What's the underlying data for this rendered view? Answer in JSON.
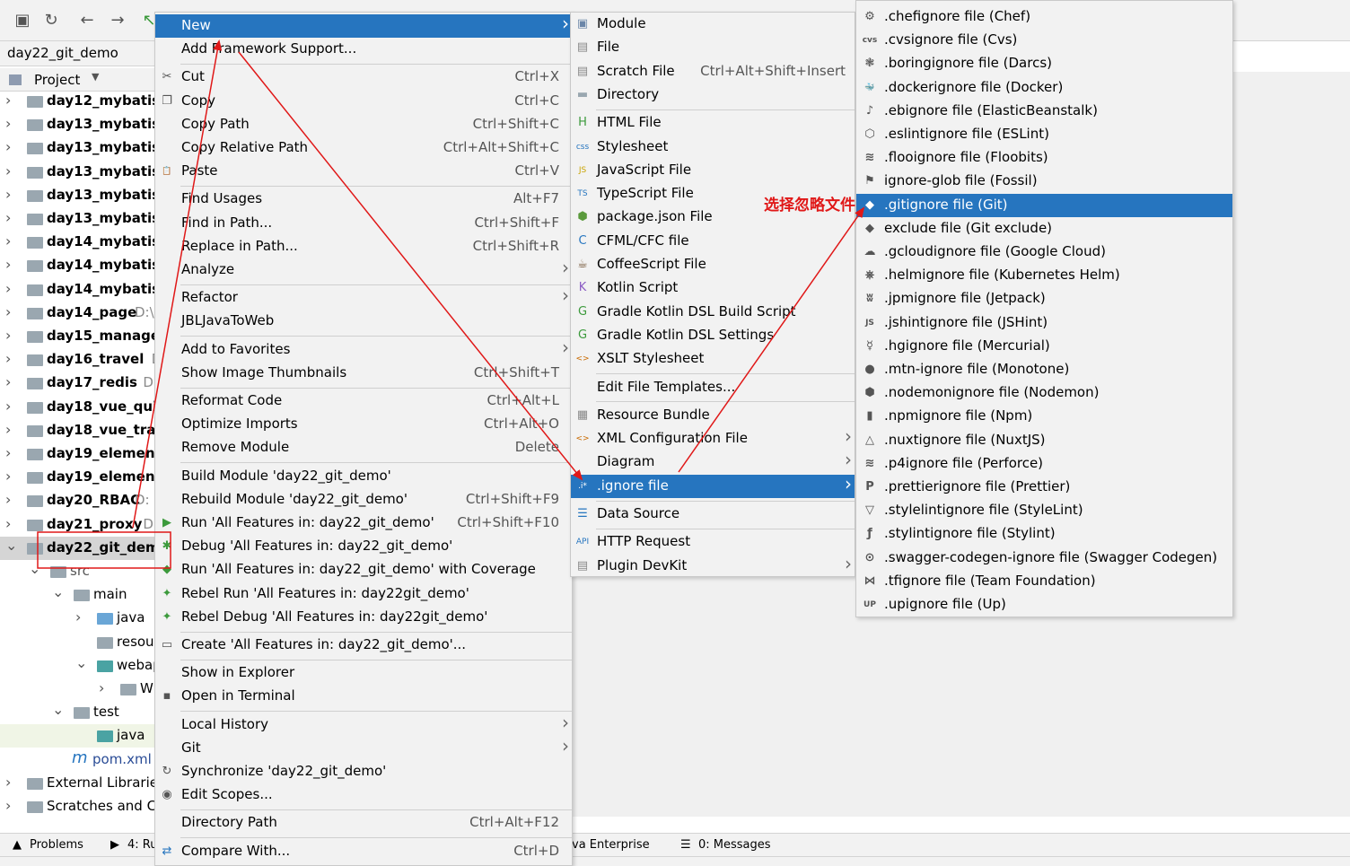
{
  "nav": {
    "project_name": "day22_git_demo"
  },
  "project_panel": {
    "title": "Project"
  },
  "tree": [
    {
      "label": "day12_mybatis",
      "level": 0,
      "expanded": false
    },
    {
      "label": "day13_mybatis_",
      "level": 0,
      "expanded": false
    },
    {
      "label": "day13_mybatis_",
      "level": 0,
      "expanded": false
    },
    {
      "label": "day13_mybatis_",
      "level": 0,
      "expanded": false
    },
    {
      "label": "day13_mybatis_",
      "level": 0,
      "expanded": false
    },
    {
      "label": "day13_mybatis_",
      "level": 0,
      "expanded": false
    },
    {
      "label": "day14_mybatis_",
      "level": 0,
      "expanded": false
    },
    {
      "label": "day14_mybatis_",
      "level": 0,
      "expanded": false
    },
    {
      "label": "day14_mybatis_",
      "level": 0,
      "expanded": false
    },
    {
      "label": "day14_page",
      "hint": "D:\\",
      "level": 0,
      "expanded": false
    },
    {
      "label": "day15_manager",
      "level": 0,
      "expanded": false
    },
    {
      "label": "day16_travel",
      "hint": "D:",
      "level": 0,
      "expanded": false
    },
    {
      "label": "day17_redis",
      "hint": "D:\\",
      "level": 0,
      "expanded": false
    },
    {
      "label": "day18_vue_quic",
      "level": 0,
      "expanded": false
    },
    {
      "label": "day18_vue_trav",
      "level": 0,
      "expanded": false
    },
    {
      "label": "day19_element",
      "level": 0,
      "expanded": false
    },
    {
      "label": "day19_element",
      "level": 0,
      "expanded": false
    },
    {
      "label": "day20_RBAC",
      "hint": "D:",
      "level": 0,
      "expanded": false
    },
    {
      "label": "day21_proxy",
      "hint": "D:",
      "level": 0,
      "expanded": false
    },
    {
      "label": "day22_git_demo",
      "level": 0,
      "expanded": true,
      "selected": true
    },
    {
      "label": "src",
      "level": 1,
      "expanded": true
    },
    {
      "label": "main",
      "level": 2,
      "expanded": true
    },
    {
      "label": "java",
      "level": 3,
      "expanded": false,
      "folder": "blue"
    },
    {
      "label": "resour",
      "level": 3,
      "leaf": true
    },
    {
      "label": "webap",
      "level": 3,
      "expanded": true,
      "folder": "teal"
    },
    {
      "label": "WI",
      "level": 4,
      "expanded": false
    },
    {
      "label": "test",
      "level": 2,
      "expanded": true
    },
    {
      "label": "java",
      "level": 3,
      "leaf": true,
      "folder": "teal",
      "highlighted": true
    },
    {
      "label": "pom.xml",
      "level": 1,
      "leaf": true,
      "file": "m"
    },
    {
      "label": "External Librarie",
      "level": 0,
      "expanded": false,
      "normal": true
    },
    {
      "label": "Scratches and Co",
      "level": 0,
      "expanded": false,
      "normal": true
    }
  ],
  "context_menu": {
    "items": [
      {
        "label": "New",
        "submenu": true,
        "active": true
      },
      {
        "label": "Add Framework Support..."
      },
      {
        "sep": true
      },
      {
        "label": "Cut",
        "shortcut": "Ctrl+X",
        "icon": "✂"
      },
      {
        "label": "Copy",
        "shortcut": "Ctrl+C",
        "icon": "❐"
      },
      {
        "label": "Copy Path",
        "shortcut": "Ctrl+Shift+C"
      },
      {
        "label": "Copy Relative Path",
        "shortcut": "Ctrl+Alt+Shift+C"
      },
      {
        "label": "Paste",
        "shortcut": "Ctrl+V",
        "icon": "📋"
      },
      {
        "sep": true
      },
      {
        "label": "Find Usages",
        "shortcut": "Alt+F7"
      },
      {
        "label": "Find in Path...",
        "shortcut": "Ctrl+Shift+F"
      },
      {
        "label": "Replace in Path...",
        "shortcut": "Ctrl+Shift+R"
      },
      {
        "label": "Analyze",
        "submenu": true
      },
      {
        "sep": true
      },
      {
        "label": "Refactor",
        "submenu": true
      },
      {
        "label": "JBLJavaToWeb"
      },
      {
        "sep": true
      },
      {
        "label": "Add to Favorites",
        "submenu": true
      },
      {
        "label": "Show Image Thumbnails",
        "shortcut": "Ctrl+Shift+T"
      },
      {
        "sep": true
      },
      {
        "label": "Reformat Code",
        "shortcut": "Ctrl+Alt+L"
      },
      {
        "label": "Optimize Imports",
        "shortcut": "Ctrl+Alt+O"
      },
      {
        "label": "Remove Module",
        "shortcut": "Delete"
      },
      {
        "sep": true
      },
      {
        "label": "Build Module 'day22_git_demo'"
      },
      {
        "label": "Rebuild Module 'day22_git_demo'",
        "shortcut": "Ctrl+Shift+F9"
      },
      {
        "label": "Run 'All Features in: day22_git_demo'",
        "shortcut": "Ctrl+Shift+F10",
        "icon": "▶",
        "iconColor": "#3c9a3c"
      },
      {
        "label": "Debug 'All Features in: day22_git_demo'",
        "icon": "✱",
        "iconColor": "#3c9a3c"
      },
      {
        "label": "Run 'All Features in: day22_git_demo' with Coverage",
        "icon": "◆",
        "iconColor": "#3c9a3c"
      },
      {
        "label": "Rebel Run 'All Features in: day22git_demo'",
        "icon": "✦",
        "iconColor": "#3c9a3c"
      },
      {
        "label": "Rebel Debug 'All Features in: day22git_demo'",
        "icon": "✦",
        "iconColor": "#3c9a3c"
      },
      {
        "sep": true
      },
      {
        "label": "Create 'All Features in: day22_git_demo'...",
        "icon": "▭"
      },
      {
        "sep": true
      },
      {
        "label": "Show in Explorer"
      },
      {
        "label": "Open in Terminal",
        "icon": "▪"
      },
      {
        "sep": true
      },
      {
        "label": "Local History",
        "submenu": true
      },
      {
        "label": "Git",
        "submenu": true
      },
      {
        "label": "Synchronize 'day22_git_demo'",
        "icon": "↻"
      },
      {
        "label": "Edit Scopes...",
        "icon": "◉"
      },
      {
        "sep": true
      },
      {
        "label": "Directory Path",
        "shortcut": "Ctrl+Alt+F12"
      },
      {
        "sep": true
      },
      {
        "label": "Compare With...",
        "shortcut": "Ctrl+D",
        "icon": "⇄",
        "iconColor": "#2675bf"
      }
    ]
  },
  "new_menu": {
    "items": [
      {
        "label": "Module",
        "icon": "▣",
        "iconColor": "#6b86a8"
      },
      {
        "label": "File",
        "icon": "▤",
        "iconColor": "#888"
      },
      {
        "label": "Scratch File",
        "shortcut": "Ctrl+Alt+Shift+Insert",
        "icon": "▤",
        "iconColor": "#888"
      },
      {
        "label": "Directory",
        "icon": "▬",
        "iconColor": "#9aa7b0"
      },
      {
        "sep": true
      },
      {
        "label": "HTML File",
        "icon": "H",
        "iconColor": "#3c9a3c"
      },
      {
        "label": "Stylesheet",
        "icon": "css",
        "iconColor": "#2675bf"
      },
      {
        "label": "JavaScript File",
        "icon": "JS",
        "iconColor": "#c9a300"
      },
      {
        "label": "TypeScript File",
        "icon": "TS",
        "iconColor": "#2675bf"
      },
      {
        "label": "package.json File",
        "icon": "⬢",
        "iconColor": "#5a9a3c"
      },
      {
        "label": "CFML/CFC file",
        "icon": "C",
        "iconColor": "#2675bf"
      },
      {
        "label": "CoffeeScript File",
        "icon": "☕",
        "iconColor": "#6b4a2a"
      },
      {
        "label": "Kotlin Script",
        "icon": "K",
        "iconColor": "#8b5cc4"
      },
      {
        "label": "Gradle Kotlin DSL Build Script",
        "icon": "G",
        "iconColor": "#3c9a3c"
      },
      {
        "label": "Gradle Kotlin DSL Settings",
        "icon": "G",
        "iconColor": "#3c9a3c"
      },
      {
        "label": "XSLT Stylesheet",
        "icon": "<>",
        "iconColor": "#c96a00"
      },
      {
        "sep": true
      },
      {
        "label": "Edit File Templates..."
      },
      {
        "sep": true
      },
      {
        "label": "Resource Bundle",
        "icon": "▦",
        "iconColor": "#888"
      },
      {
        "label": "XML Configuration File",
        "submenu": true,
        "icon": "<>",
        "iconColor": "#c96a00"
      },
      {
        "label": "Diagram",
        "submenu": true
      },
      {
        "label": ".ignore file",
        "submenu": true,
        "active": true,
        "icon": ".i*"
      },
      {
        "sep": true
      },
      {
        "label": "Data Source",
        "icon": "☰",
        "iconColor": "#2675bf"
      },
      {
        "sep": true
      },
      {
        "label": "HTTP Request",
        "icon": "API",
        "iconColor": "#2675bf"
      },
      {
        "label": "Plugin DevKit",
        "submenu": true,
        "icon": "▤",
        "iconColor": "#888"
      }
    ]
  },
  "ignore_menu": {
    "items": [
      {
        "label": ".chefignore file (Chef)",
        "icon": "⚙"
      },
      {
        "label": ".cvsignore file (Cvs)",
        "icon": "cvs"
      },
      {
        "label": ".boringignore file (Darcs)",
        "icon": "❃"
      },
      {
        "label": ".dockerignore file (Docker)",
        "icon": "🐳"
      },
      {
        "label": ".ebignore file (ElasticBeanstalk)",
        "icon": "♪"
      },
      {
        "label": ".eslintignore file (ESLint)",
        "icon": "⬡"
      },
      {
        "label": ".flooignore file (Floobits)",
        "icon": "≋"
      },
      {
        "label": "ignore-glob file (Fossil)",
        "icon": "⚑"
      },
      {
        "label": ".gitignore file (Git)",
        "icon": "◆",
        "active": true
      },
      {
        "label": "exclude file (Git exclude)",
        "icon": "◆"
      },
      {
        "label": ".gcloudignore file (Google Cloud)",
        "icon": "☁"
      },
      {
        "label": ".helmignore file (Kubernetes Helm)",
        "icon": "⎈"
      },
      {
        "label": ".jpmignore file (Jetpack)",
        "icon": "ʬ"
      },
      {
        "label": ".jshintignore file (JSHint)",
        "icon": "JS"
      },
      {
        "label": ".hgignore file (Mercurial)",
        "icon": "☿"
      },
      {
        "label": ".mtn-ignore file (Monotone)",
        "icon": "●"
      },
      {
        "label": ".nodemonignore file (Nodemon)",
        "icon": "⬢"
      },
      {
        "label": ".npmignore file (Npm)",
        "icon": "▮"
      },
      {
        "label": ".nuxtignore file (NuxtJS)",
        "icon": "△"
      },
      {
        "label": ".p4ignore file (Perforce)",
        "icon": "≋"
      },
      {
        "label": ".prettierignore file (Prettier)",
        "icon": "P"
      },
      {
        "label": ".stylelintignore file (StyleLint)",
        "icon": "▽"
      },
      {
        "label": ".stylintignore file (Stylint)",
        "icon": "ƒ"
      },
      {
        "label": ".swagger-codegen-ignore file (Swagger Codegen)",
        "icon": "⊙"
      },
      {
        "label": ".tfignore file (Team Foundation)",
        "icon": "⋈"
      },
      {
        "label": ".upignore file (Up)",
        "icon": "UP"
      }
    ]
  },
  "bottom": {
    "problems": "Problems",
    "run_tab": "4: Ru",
    "java_ent": "va Enterprise",
    "messages": "0: Messages"
  },
  "annotation": {
    "text": "选择忽略文件",
    "color": "#e01818"
  }
}
